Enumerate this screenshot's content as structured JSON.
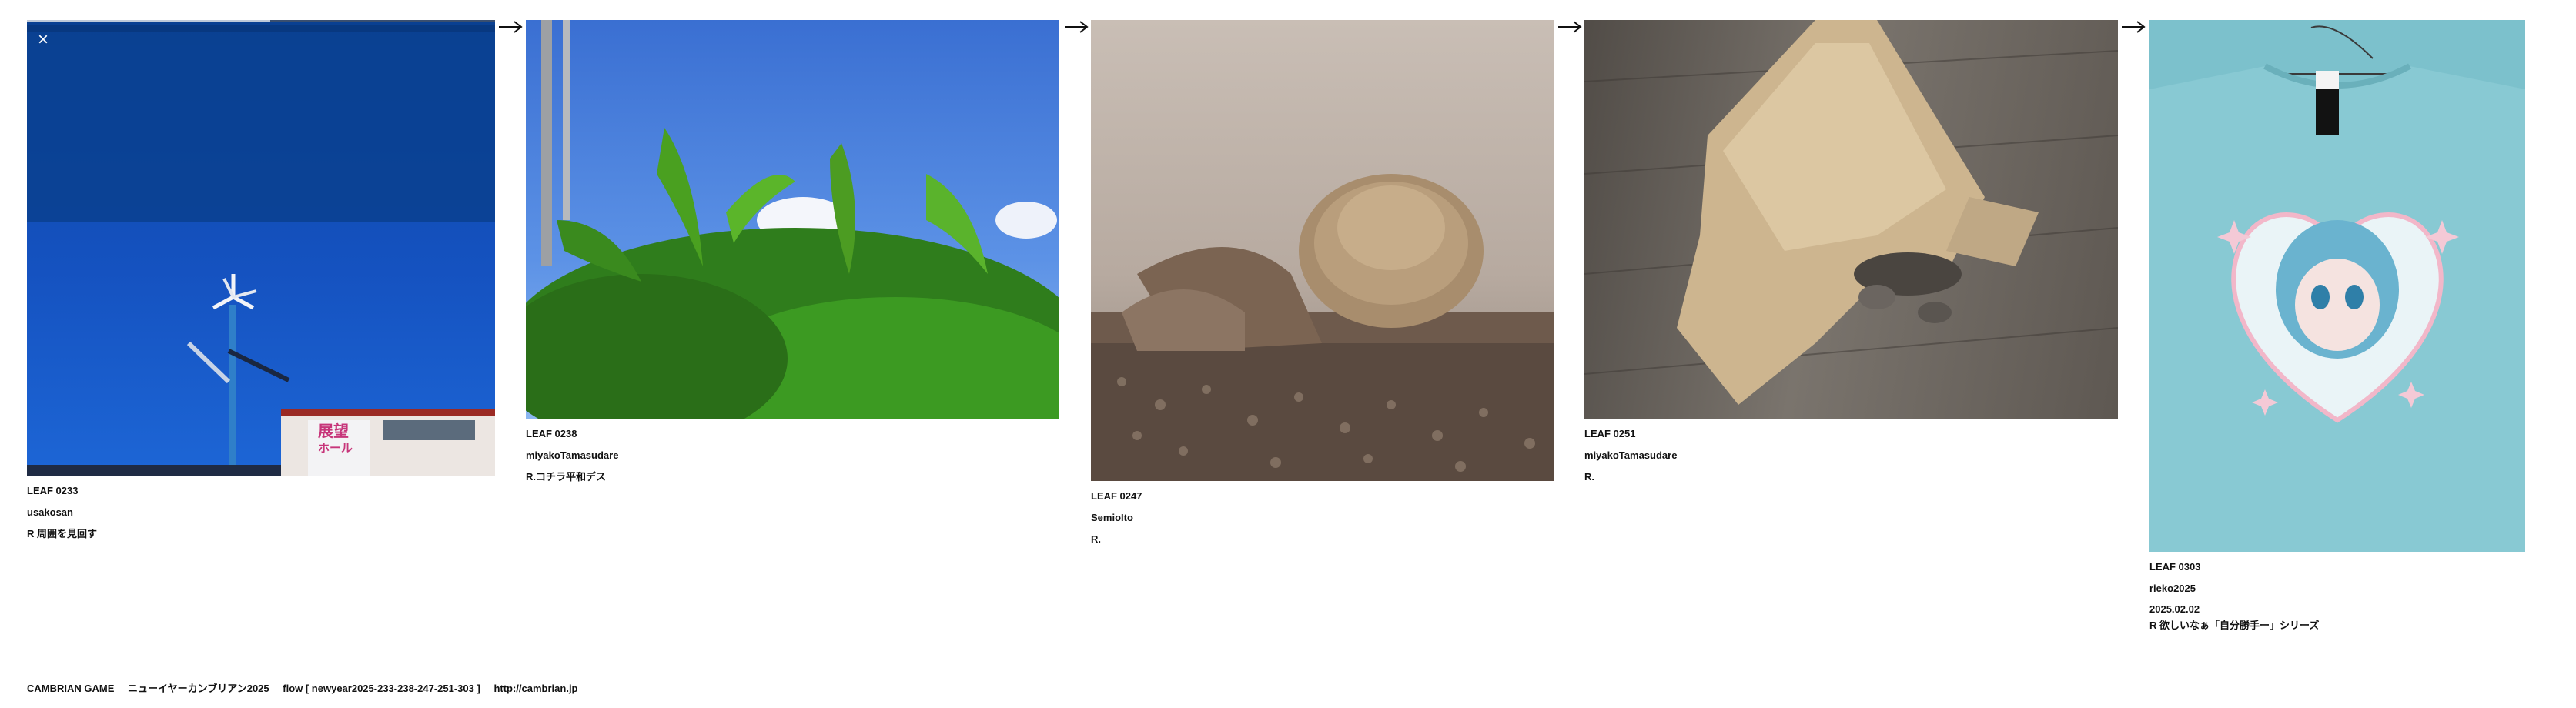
{
  "overlay": {
    "close_glyph": "×",
    "handle_glyph": "•••"
  },
  "arrow_glyph": "→",
  "leaves": [
    {
      "number": "LEAF 0233",
      "author": "usakosan",
      "note": "R 周囲を見回す"
    },
    {
      "number": "LEAF 0238",
      "author": "miyakoTamasudare",
      "note": "R.コチラ平和デス"
    },
    {
      "number": "LEAF 0247",
      "author": "SemioIto",
      "note": "R."
    },
    {
      "number": "LEAF 0251",
      "author": "miyakoTamasudare",
      "note": "R."
    },
    {
      "number": "LEAF 0303",
      "author": "rieko2025",
      "date": "2025.02.02",
      "note": "R 欲しいなぁ「自分勝手ー」シリーズ"
    }
  ],
  "sign": {
    "line1": "展望",
    "line2": "ホール"
  },
  "footer": {
    "brand": "CAMBRIAN GAME",
    "event": "ニューイヤーカンブリアン2025",
    "flow": "flow [ newyear2025-233-238-247-251-303 ]",
    "url": "http://cambrian.jp"
  },
  "colors": {
    "text": "#111111",
    "background": "#ffffff",
    "overlay": "#0a3f8e"
  }
}
